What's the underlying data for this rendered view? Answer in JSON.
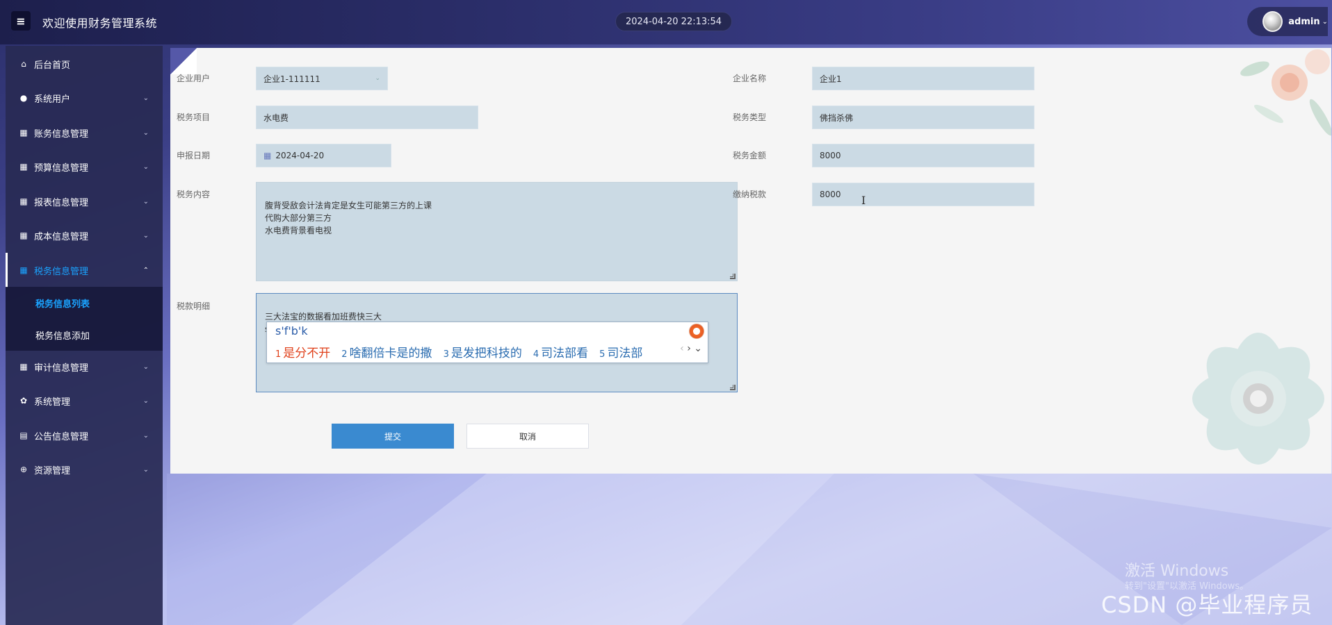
{
  "header": {
    "menu_icon": "hamburger-icon",
    "title": "欢迎使用财务管理系统",
    "datetime": "2024-04-20 22:13:54",
    "user": "admin"
  },
  "sidebar": {
    "items": [
      {
        "label": "后台首页",
        "icon": "home-icon"
      },
      {
        "label": "系统用户",
        "icon": "user-icon"
      },
      {
        "label": "账务信息管理",
        "icon": "grid-icon"
      },
      {
        "label": "预算信息管理",
        "icon": "grid-icon"
      },
      {
        "label": "报表信息管理",
        "icon": "grid-icon"
      },
      {
        "label": "成本信息管理",
        "icon": "grid-icon"
      },
      {
        "label": "税务信息管理",
        "icon": "grid-icon"
      },
      {
        "label": "审计信息管理",
        "icon": "grid-icon"
      },
      {
        "label": "系统管理",
        "icon": "gear-icon"
      },
      {
        "label": "公告信息管理",
        "icon": "document-icon"
      },
      {
        "label": "资源管理",
        "icon": "plus-circle-icon"
      }
    ],
    "subitems": [
      {
        "label": "税务信息列表"
      },
      {
        "label": "税务信息添加"
      }
    ]
  },
  "form": {
    "enterprise_user": {
      "label": "企业用户",
      "value": "企业1-111111"
    },
    "enterprise_name": {
      "label": "企业名称",
      "value": "企业1"
    },
    "tax_item": {
      "label": "税务项目",
      "value": "水电费"
    },
    "tax_type": {
      "label": "税务类型",
      "value": "佛挡杀佛"
    },
    "report_date": {
      "label": "申报日期",
      "value": "2024-04-20"
    },
    "tax_amount": {
      "label": "税务金额",
      "value": "8000"
    },
    "tax_content": {
      "label": "税务内容",
      "value": "腹背受敌会计法肯定是女生可能第三方的上课\n代购大部分第三方\n水电费背景看电视"
    },
    "tax_paid": {
      "label": "缴纳税款",
      "value": "8000"
    },
    "tax_detail": {
      "label": "税款明细",
      "value": "三大法宝的数据看加班费快三大\nsfbk"
    },
    "submit": "提交",
    "cancel": "取消"
  },
  "ime": {
    "input": "s'f'b'k",
    "candidates": [
      {
        "n": "1",
        "text": "是分不开"
      },
      {
        "n": "2",
        "text": "啥翻倍卡是的撒"
      },
      {
        "n": "3",
        "text": "是发把科技的"
      },
      {
        "n": "4",
        "text": "司法部看"
      },
      {
        "n": "5",
        "text": "司法部"
      }
    ]
  },
  "watermark": {
    "line1": "激活 Windows",
    "line2": "转到\"设置\"以激活 Windows。",
    "csdn": "CSDN @毕业程序员"
  },
  "colors": {
    "accent": "#1aa3ff",
    "primary_button": "#3a8ad0",
    "field_bg": "#cbdae4",
    "sidebar_bg": "#282a54"
  }
}
